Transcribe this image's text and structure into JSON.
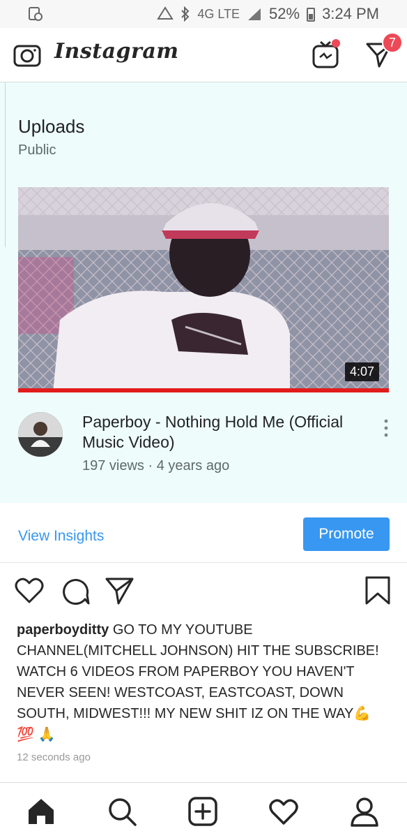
{
  "status_bar": {
    "network": "4G LTE",
    "battery": "52%",
    "time": "3:24 PM"
  },
  "header": {
    "brand": "Instagram",
    "dm_badge_count": "7",
    "icons": [
      "camera-icon",
      "igtv-icon",
      "direct-message-icon"
    ]
  },
  "post": {
    "media": {
      "section_title": "Uploads",
      "section_subtitle": "Public",
      "duration": "4:07",
      "progress_fraction": 1.0,
      "video_title": "Paperboy - Nothing Hold Me (Official Music Video)",
      "video_meta": "197 views · 4 years ago"
    },
    "insights": {
      "view_insights_label": "View Insights",
      "promote_label": "Promote"
    },
    "actions": [
      "heart-icon",
      "comment-icon",
      "share-icon",
      "bookmark-icon"
    ],
    "caption": {
      "username": "paperboyditty",
      "text": "GO TO MY YOUTUBE CHANNEL(MITCHELL JOHNSON) HIT THE SUBSCRIBE! WATCH 6 VIDEOS FROM PAPERBOY YOU HAVEN'T NEVER SEEN! WESTCOAST, EASTCOAST, DOWN SOUTH, MIDWEST!!! MY NEW SHIT IZ ON THE WAY💪 💯 🙏"
    },
    "timestamp": "12 seconds ago"
  },
  "bottom_nav": [
    "home-icon",
    "search-icon",
    "new-post-icon",
    "activity-icon",
    "profile-icon"
  ],
  "colors": {
    "accent": "#3897f0",
    "badge": "#ed4956",
    "media_bg": "#eefcfc",
    "progress": "#e31b1b"
  }
}
